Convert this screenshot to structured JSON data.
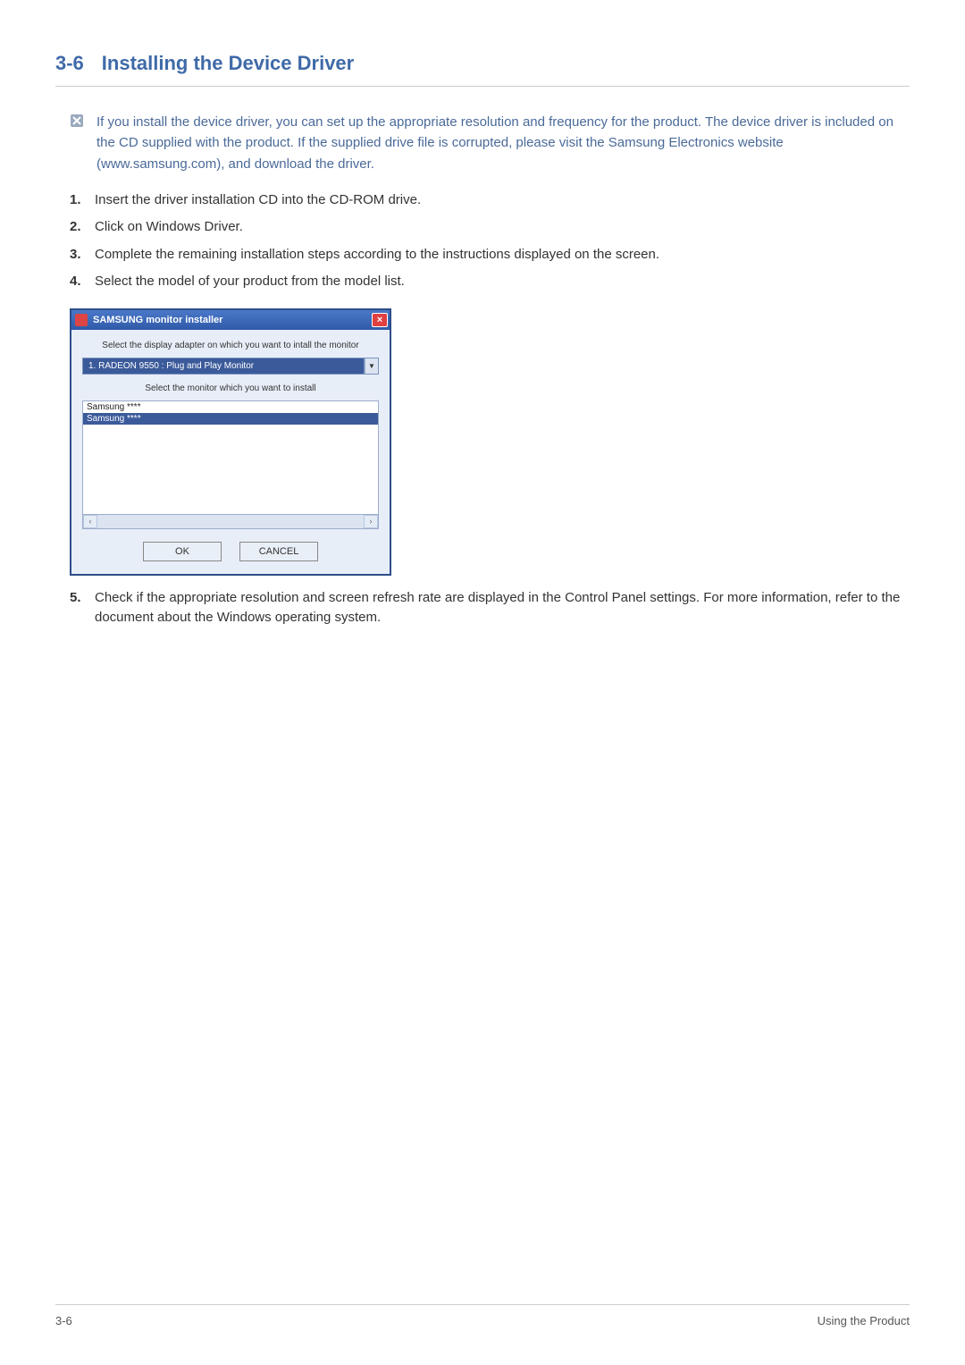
{
  "section": {
    "number": "3-6",
    "title": "Installing the Device Driver"
  },
  "note": {
    "text": "If you install the device driver, you can set up the appropriate resolution and frequency for the product. The device driver is included on the CD supplied with the product. If the supplied drive file is corrupted, please visit the Samsung Electronics website (www.samsung.com), and download the driver."
  },
  "steps": [
    "Insert the driver installation CD into the CD-ROM drive.",
    "Click on Windows Driver.",
    "Complete the remaining installation steps according to the instructions displayed on the screen.",
    "Select the model of your product from the model list."
  ],
  "installer": {
    "title": "SAMSUNG monitor installer",
    "label_adapter": "Select the display adapter on which you want to intall the monitor",
    "dropdown_value": "1. RADEON 9550 : Plug and Play Monitor",
    "label_monitor": "Select the monitor which you want to install",
    "list_items": [
      "Samsung ****",
      "Samsung ****"
    ],
    "selected_index": 1,
    "ok_label": "OK",
    "cancel_label": "CANCEL",
    "close_label": "×"
  },
  "step5": "Check if the appropriate resolution and screen refresh rate are displayed in the Control Panel settings. For more information, refer to the document about the Windows operating system.",
  "footer": {
    "left": "3-6",
    "right": "Using the Product"
  }
}
